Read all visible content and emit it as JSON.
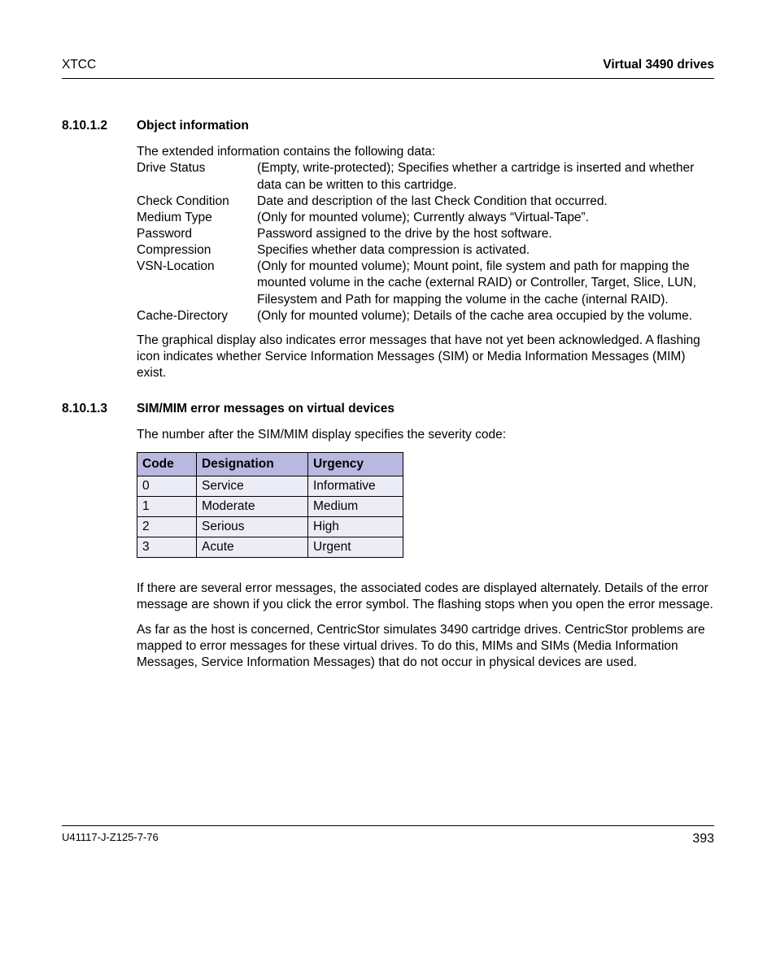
{
  "header": {
    "left": "XTCC",
    "right": "Virtual 3490 drives"
  },
  "sec1": {
    "num": "8.10.1.2",
    "title": "Object information",
    "intro": "The extended information contains the following data:",
    "defs": [
      {
        "term": "Drive Status",
        "desc": "(Empty, write-protected); Specifies whether a cartridge is inserted and whether data can be written to this cartridge."
      },
      {
        "term": "Check Condition",
        "desc": "Date and description of the last Check Condition that occurred."
      },
      {
        "term": "Medium Type",
        "desc": "(Only for mounted volume); Currently always “Virtual-Tape”."
      },
      {
        "term": "Password",
        "desc": "Password assigned to the drive by the host software."
      },
      {
        "term": "Compression",
        "desc": "Specifies whether data compression is activated."
      },
      {
        "term": "VSN-Location",
        "desc": "(Only for mounted volume); Mount point, file system and path for mapping the mounted volume in the cache (external RAID) or Controller, Target, Slice, LUN, Filesystem and Path for mapping the volume in the cache (internal RAID)."
      },
      {
        "term": "Cache-Directory",
        "desc": "(Only for mounted volume); Details of the cache area occupied by the volume."
      }
    ],
    "trailer": "The graphical display also indicates error messages that have not yet been acknowledged. A flashing icon indicates whether Service Information Messages (SIM) or Media Information Messages (MIM) exist."
  },
  "sec2": {
    "num": "8.10.1.3",
    "title": "SIM/MIM error messages on virtual devices",
    "intro": "The number after the SIM/MIM display specifies the severity code:",
    "table": {
      "headers": [
        "Code",
        "Designation",
        "Urgency"
      ],
      "rows": [
        [
          "0",
          "Service",
          "Informative"
        ],
        [
          "1",
          "Moderate",
          "Medium"
        ],
        [
          "2",
          "Serious",
          "High"
        ],
        [
          "3",
          "Acute",
          "Urgent"
        ]
      ]
    },
    "p1": "If there are several error messages, the associated codes are displayed alternately. Details of the error message are shown if you click the error symbol. The flashing stops when you open the error message.",
    "p2": "As far as the host is concerned, CentricStor simulates 3490 cartridge drives. CentricStor problems are mapped to error messages for these virtual drives. To do this, MIMs and SIMs (Media Information Messages, Service Information Messages) that do not occur in physical devices are used."
  },
  "footer": {
    "left": "U41117-J-Z125-7-76",
    "right": "393"
  }
}
